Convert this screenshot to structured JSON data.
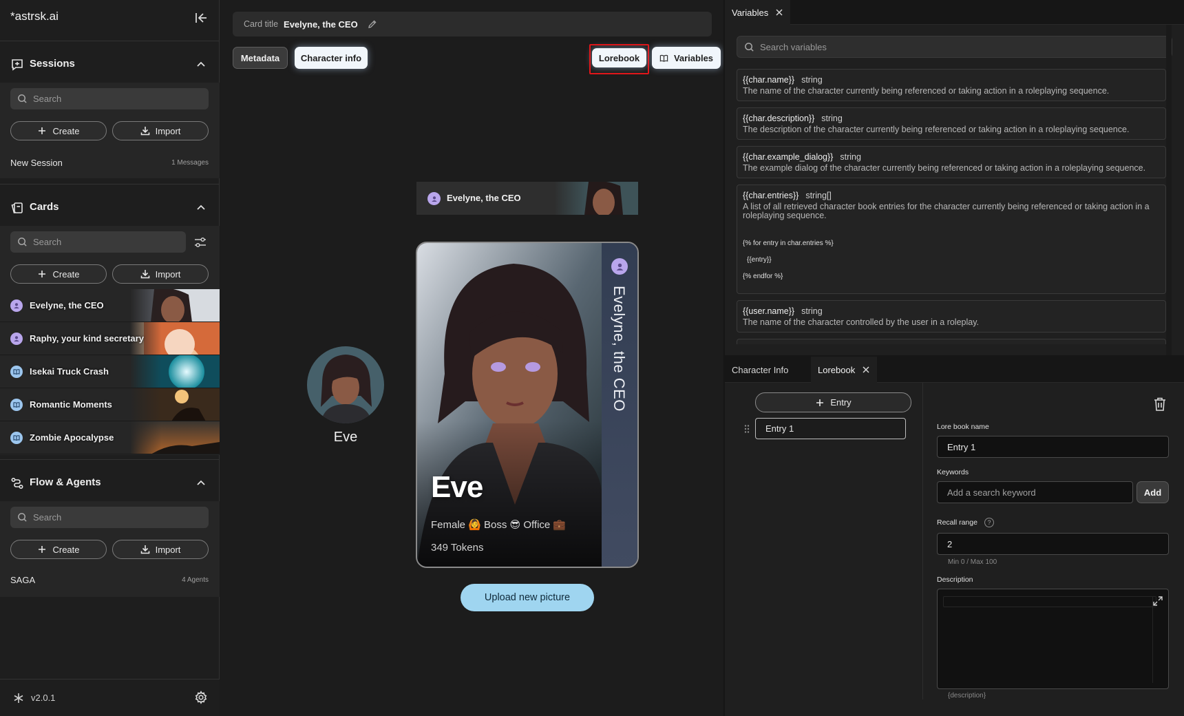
{
  "brand": "*astrsk.ai",
  "sidebar": {
    "sessions": {
      "title": "Sessions",
      "search_placeholder": "Search",
      "create_label": "Create",
      "import_label": "Import",
      "items": [
        {
          "name": "New Session",
          "count": "1 Messages"
        }
      ]
    },
    "cards": {
      "title": "Cards",
      "search_placeholder": "Search",
      "create_label": "Create",
      "import_label": "Import",
      "items": [
        {
          "name": "Evelyne, the CEO",
          "kind": "character"
        },
        {
          "name": "Raphy, your kind secretary",
          "kind": "character"
        },
        {
          "name": "Isekai Truck Crash",
          "kind": "plot"
        },
        {
          "name": "Romantic Moments",
          "kind": "plot"
        },
        {
          "name": "Zombie Apocalypse",
          "kind": "plot"
        }
      ]
    },
    "flows": {
      "title": "Flow & Agents",
      "search_placeholder": "Search",
      "create_label": "Create",
      "import_label": "Import",
      "items": [
        {
          "name": "SAGA",
          "count": "4 Agents"
        }
      ]
    },
    "version": "v2.0.1"
  },
  "main": {
    "card_title_label": "Card title",
    "card_title_value": "Evelyne, the CEO",
    "tabs": [
      {
        "label": "Metadata"
      },
      {
        "label": "Character info"
      },
      {
        "label": "Lorebook"
      },
      {
        "label": "Variables"
      }
    ],
    "header_name": "Evelyne, the CEO",
    "avatar_name": "Eve",
    "card": {
      "name": "Eve",
      "vertical_title": "Evelyne, the CEO",
      "tags": "Female 🙆 Boss 😎 Office 💼",
      "tokens": "349 Tokens"
    },
    "upload_label": "Upload new picture"
  },
  "variables_panel": {
    "tab_label": "Variables",
    "search_placeholder": "Search variables",
    "items": [
      {
        "name": "{{char.name}}",
        "type": "string",
        "desc": "The name of the character currently being referenced or taking action in a roleplaying sequence."
      },
      {
        "name": "{{char.description}}",
        "type": "string",
        "desc": "The description of the character currently being referenced or taking action in a roleplaying sequence."
      },
      {
        "name": "{{char.example_dialog}}",
        "type": "string",
        "desc": "The example dialog of the character currently being referenced or taking action in a roleplaying sequence."
      },
      {
        "name": "{{char.entries}}",
        "type": "string[]",
        "desc": "A list of all retrieved character book entries for the character currently being referenced or taking action in a roleplaying sequence.",
        "code": [
          "{% for entry in char.entries %}",
          "  {{entry}}",
          "{% endfor %}"
        ]
      },
      {
        "name": "{{user.name}}",
        "type": "string",
        "desc": "The name of the character controlled by the user in a roleplay."
      }
    ]
  },
  "lorebook_panel": {
    "tabs": [
      {
        "label": "Character Info"
      },
      {
        "label": "Lorebook"
      }
    ],
    "add_entry_label": "Entry",
    "entries": [
      {
        "label": "Entry 1"
      }
    ],
    "name_label": "Lore book name",
    "name_value": "Entry 1",
    "keywords_label": "Keywords",
    "keywords_placeholder": "Add a search keyword",
    "add_label": "Add",
    "recall_label": "Recall range",
    "recall_value": "2",
    "recall_hint": "Min 0 / Max 100",
    "description_label": "Description",
    "description_hint": "{description}"
  },
  "colors": {
    "accent": "#9fd5f0",
    "avatar_purple": "#b9a6ec",
    "avatar_blue": "#9cc6ee",
    "highlight": "#e0161a"
  }
}
